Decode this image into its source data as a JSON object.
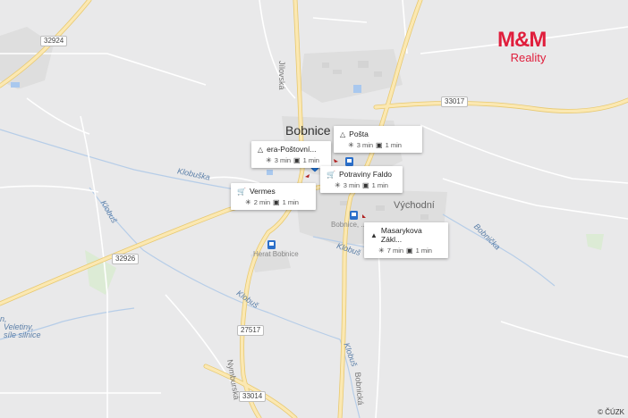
{
  "map": {
    "town_label": "Bobnice",
    "district_label": "Východní",
    "partial_label": "Bobnice, ...",
    "street_labels": {
      "jilovska": "Jílovská",
      "klobuska": "Klobuška",
      "klobus_1": "Klobuš",
      "klobus_2": "Klobuš",
      "klobus_3": "Klobuš",
      "klobus_4": "Klobuš",
      "bobnicka": "Bobnička",
      "nymburska": "Nymburská",
      "bobnicka2": "Bobnická"
    },
    "place_labels": {
      "herat": "Herat Bobnice"
    },
    "water_label_lines": [
      "Veletiny,",
      "síle silnice"
    ],
    "water_label_prefix": "n,",
    "road_numbers": [
      "32924",
      "33017",
      "32926",
      "27517",
      "33014"
    ],
    "copyright": "© ČÚZK"
  },
  "logo": {
    "brand": "M&M",
    "sub": "Reality",
    "color": "#e01e3c"
  },
  "pois": [
    {
      "name": "era-Poštovní...",
      "icon": "bank-icon",
      "walk": "3 min",
      "drive": "1 min"
    },
    {
      "name": "Pošta",
      "icon": "bank-icon",
      "walk": "3 min",
      "drive": "1 min"
    },
    {
      "name": "Potraviny Faldo",
      "icon": "cart-icon",
      "walk": "3 min",
      "drive": "1 min"
    },
    {
      "name": "Vermes",
      "icon": "cart-icon",
      "walk": "2 min",
      "drive": "1 min"
    },
    {
      "name": "Masarykova Zákl...",
      "icon": "school-icon",
      "walk": "7 min",
      "drive": "1 min"
    }
  ],
  "colors": {
    "pin": "#1f73d6",
    "road_major": "#f7e6a8",
    "road_edge": "#e6c66a"
  }
}
